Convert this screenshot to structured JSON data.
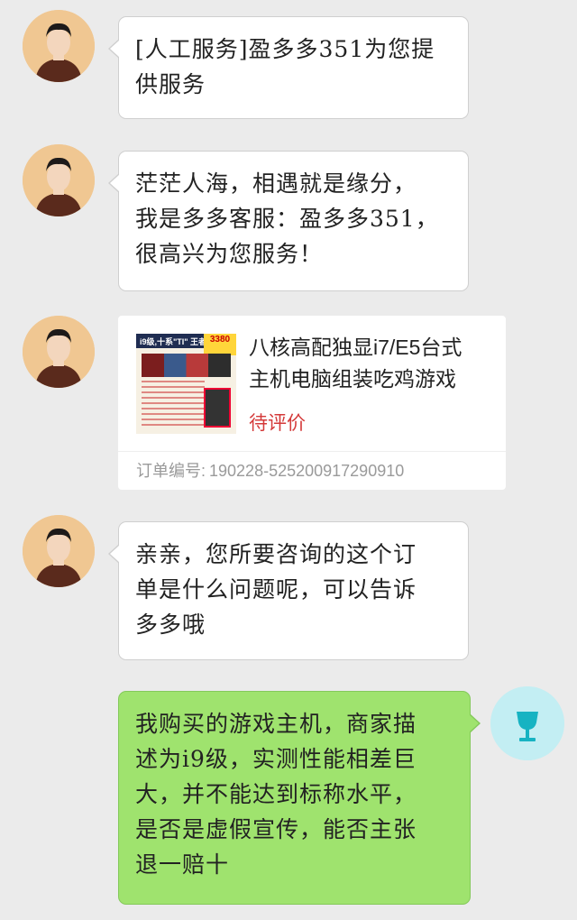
{
  "messages": [
    {
      "from": "agent",
      "text_lines": [
        "[人工服务]盈多多351为您提",
        "供服务"
      ]
    },
    {
      "from": "agent",
      "text_lines": [
        "茫茫人海，相遇就是缘分，",
        "我是多多客服：盈多多351，",
        "很高兴为您服务！"
      ]
    },
    {
      "from": "agent",
      "order_card": {
        "title_lines": [
          "八核高配独显i7/E5台式",
          "主机电脑组装吃鸡游戏"
        ],
        "status": "待评价",
        "order_label": "订单编号:",
        "order_number": "190228-525200917290910",
        "thumb_text": "i9级,十系\"TI\" 王者",
        "thumb_price": "3380"
      }
    },
    {
      "from": "agent",
      "text_lines": [
        "亲亲，您所要咨询的这个订",
        "单是什么问题呢，可以告诉",
        "多多哦"
      ]
    },
    {
      "from": "user",
      "text_lines": [
        "我购买的游戏主机，商家描",
        "述为i9级，实测性能相差巨",
        "大，并不能达到标称水平，",
        "是否是虚假宣传，能否主张",
        "退一赔十"
      ]
    }
  ],
  "colors": {
    "background": "#ebebeb",
    "agent_bubble": "#ffffff",
    "user_bubble": "#9fe36e",
    "status_red": "#d43a3a",
    "user_avatar_bg": "#c3eef3",
    "user_avatar_icon": "#17b3c2"
  },
  "icons": {
    "agent_avatar": "agent-avatar-photo",
    "user_avatar": "wine-glass-icon"
  }
}
